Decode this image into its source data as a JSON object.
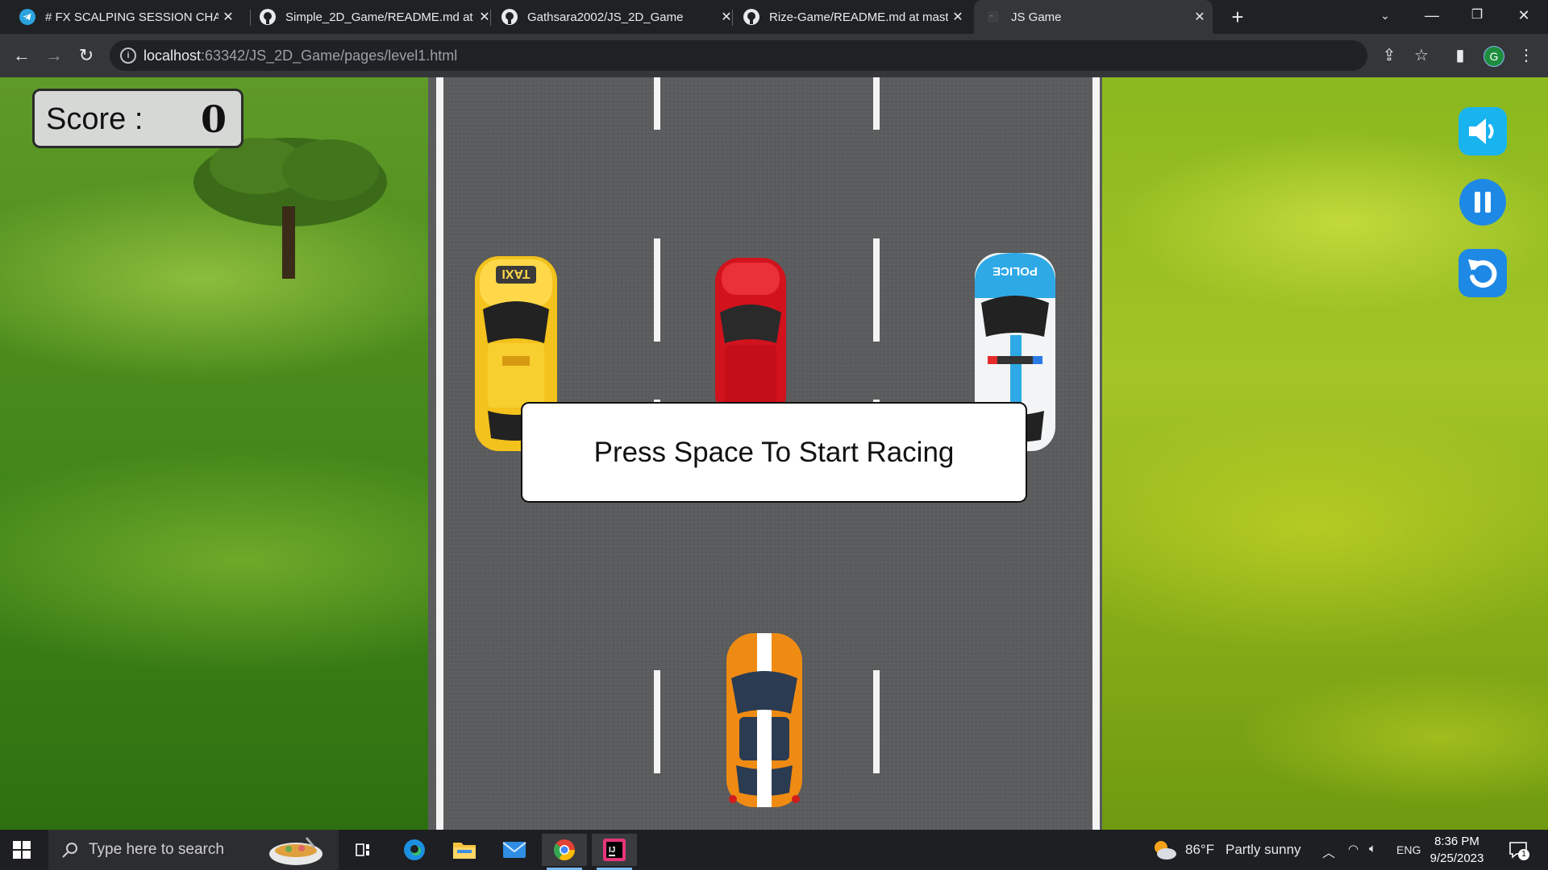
{
  "browser": {
    "tabs": [
      {
        "title": "# FX SCALPING SESSION CHAT",
        "icon": "telegram-icon",
        "active": false
      },
      {
        "title": "Simple_2D_Game/README.md at",
        "icon": "github-icon",
        "active": false
      },
      {
        "title": "Gathsara2002/JS_2D_Game",
        "icon": "github-icon",
        "active": false
      },
      {
        "title": "Rize-Game/README.md at mast",
        "icon": "github-icon",
        "active": false
      },
      {
        "title": "JS Game",
        "icon": "page-icon",
        "active": true
      }
    ],
    "url_host": "localhost",
    "url_path": ":63342/JS_2D_Game/pages/level1.html",
    "profile_initial": "G"
  },
  "game": {
    "score_label": "Score :",
    "score_value": "0",
    "start_message": "Press Space To Start Racing",
    "cars": {
      "taxi_label": "TAXI",
      "police_label": "POLICE"
    },
    "controls": [
      "sound-on-icon",
      "pause-icon",
      "restart-icon"
    ],
    "colors": {
      "control_blue": "#1e88e5",
      "control_cyan": "#18b4f0"
    }
  },
  "taskbar": {
    "search_placeholder": "Type here to search",
    "weather_temp": "86°F",
    "weather_desc": "Partly sunny",
    "language": "ENG",
    "time": "8:36 PM",
    "date": "9/25/2023",
    "notification_count": "1"
  }
}
